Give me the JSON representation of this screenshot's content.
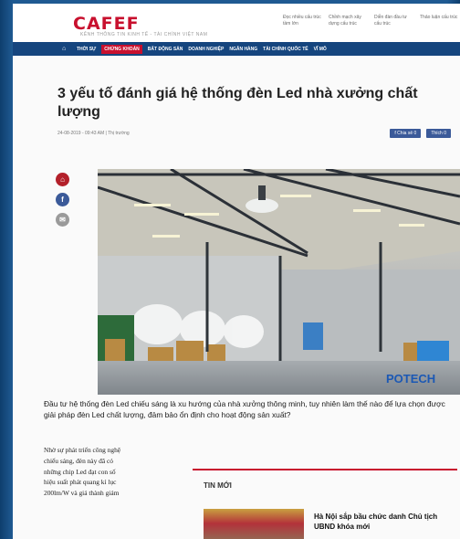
{
  "header": {
    "logo": "CAFEF",
    "logo_sub": "KÊNH THÔNG TIN KINH TẾ - TÀI CHÍNH VIỆT NAM",
    "top_links": [
      "Đọc nhiều cấu trúc tầm lớn",
      "Chỉnh mạch xây dựng cấu trúc",
      "Diễn đàn đầu tư cấu trúc",
      "Thảo luận cấu trúc"
    ]
  },
  "nav": {
    "home_icon": "home-icon",
    "items": [
      "THỜI SỰ",
      "CHỨNG KHOÁN",
      "BẤT ĐỘNG SẢN",
      "DOANH NGHIỆP",
      "NGÂN HÀNG",
      "TÀI CHÍNH QUỐC TẾ",
      "VĨ MÔ"
    ],
    "active_index": 1
  },
  "article": {
    "title": "3 yếu tố đánh giá hệ thống đèn Led nhà xưởng chất lượng",
    "meta": "24-08-2019 - 09:43 AM | Thị trường",
    "share": [
      "f Chia sẻ 0",
      "Thích 0"
    ],
    "side_icons": [
      "home-icon",
      "facebook-icon",
      "mail-icon"
    ],
    "photo_brand": "POTECH",
    "lead": "Đầu tư hệ thống đèn Led chiếu sáng là xu hướng của nhà xưởng thông minh, tuy nhiên làm thế nào để lựa chọn được giải pháp đèn Led chất lượng, đảm bảo ổn định cho hoạt động sản xuất?",
    "body_lines": [
      "Nhờ sự phát triển công nghệ",
      "chiếu sáng, đèn này đã có",
      "những chip Led đạt con số",
      "hiệu suất phát quang kỉ lục",
      "200lm/W và giá thành giảm"
    ]
  },
  "news": {
    "heading": "TIN MỚI",
    "item_title": "Hà Nội sắp bầu chức danh Chủ tịch UBND khóa mới"
  },
  "colors": {
    "brand": "#c8102e",
    "nav": "#15457e",
    "frame": "#1f5a92"
  }
}
